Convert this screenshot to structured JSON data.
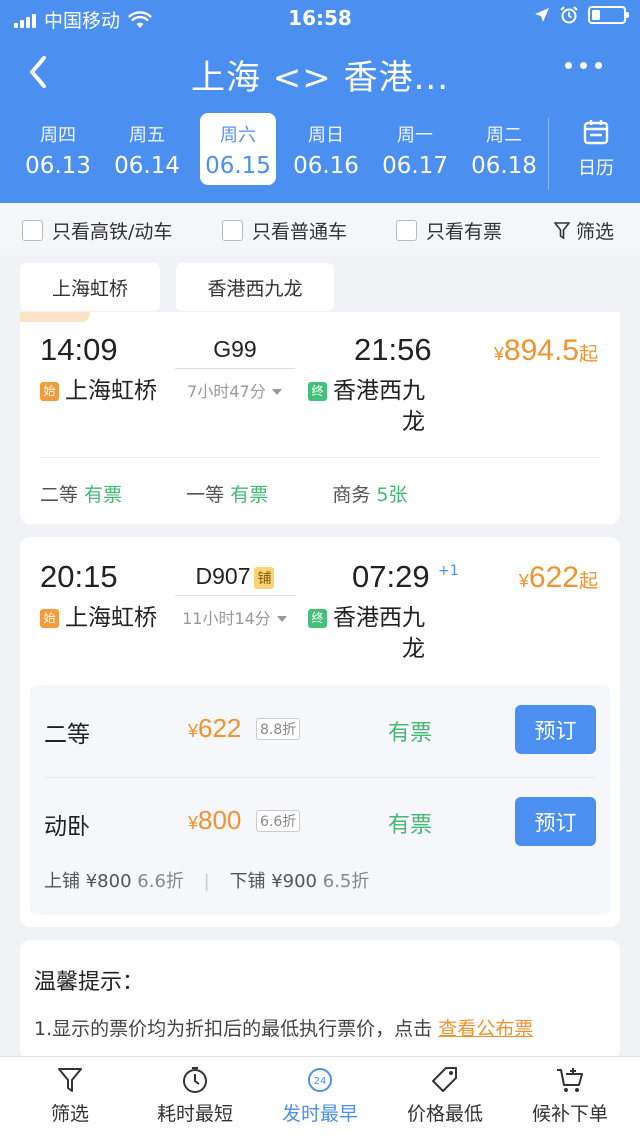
{
  "status_bar": {
    "carrier": "中国移动",
    "time": "16:58"
  },
  "nav": {
    "title": "上海 <> 香港..."
  },
  "dates": [
    {
      "weekday": "周四",
      "date": "06.13",
      "active": false
    },
    {
      "weekday": "周五",
      "date": "06.14",
      "active": false
    },
    {
      "weekday": "周六",
      "date": "06.15",
      "active": true
    },
    {
      "weekday": "周日",
      "date": "06.16",
      "active": false
    },
    {
      "weekday": "周一",
      "date": "06.17",
      "active": false
    },
    {
      "weekday": "周二",
      "date": "06.18",
      "active": false
    }
  ],
  "calendar_label": "日历",
  "filters": {
    "high_speed_only": "只看高铁/动车",
    "regular_only": "只看普通车",
    "available_only": "只看有票",
    "filter_label": "筛选"
  },
  "station_tabs": [
    "上海虹桥",
    "香港西九龙"
  ],
  "trains": [
    {
      "depart_time": "14:09",
      "arrive_time": "21:56",
      "train_no": "G99",
      "duration": "7小时47分",
      "from_tag": "始",
      "from": "上海虹桥",
      "to_tag": "终",
      "to_line1": "香港西九",
      "to_line2": "龙",
      "price_symbol": "¥",
      "price_value": "894.5",
      "price_suffix": "起",
      "seats": [
        {
          "class": "二等",
          "status": "有票"
        },
        {
          "class": "一等",
          "status": "有票"
        },
        {
          "class": "商务",
          "status": "5张"
        }
      ]
    },
    {
      "depart_time": "20:15",
      "arrive_time": "07:29",
      "day_offset": "+1",
      "train_no": "D907",
      "badge": "铺",
      "duration": "11小时14分",
      "from_tag": "始",
      "from": "上海虹桥",
      "to_tag": "终",
      "to_line1": "香港西九",
      "to_line2": "龙",
      "price_symbol": "¥",
      "price_value": "622",
      "price_suffix": "起",
      "seat_details": [
        {
          "class": "二等",
          "symbol": "¥",
          "price": "622",
          "discount": "8.8折",
          "status": "有票",
          "button": "预订"
        },
        {
          "class": "动卧",
          "symbol": "¥",
          "price": "800",
          "discount": "6.6折",
          "status": "有票",
          "button": "预订"
        }
      ],
      "berths": {
        "upper_label": "上铺",
        "upper_price": "¥800",
        "upper_discount": "6.6折",
        "lower_label": "下铺",
        "lower_price": "¥900",
        "lower_discount": "6.5折"
      }
    }
  ],
  "tips": {
    "title": "温馨提示：",
    "text": "1.显示的票价均为折扣后的最低执行票价，点击",
    "link": "查看公布票"
  },
  "bottom_nav": [
    {
      "label": "筛选",
      "icon": "filter-icon",
      "active": false
    },
    {
      "label": "耗时最短",
      "icon": "clock-icon",
      "active": false
    },
    {
      "label": "发时最早",
      "icon": "24h-icon",
      "active": true
    },
    {
      "label": "价格最低",
      "icon": "price-tag-icon",
      "active": false
    },
    {
      "label": "候补下单",
      "icon": "cart-plus-icon",
      "active": false
    }
  ],
  "colors": {
    "brand_blue": "#4b8ff0",
    "price_orange": "#f0932f",
    "available_green": "#45b974"
  }
}
